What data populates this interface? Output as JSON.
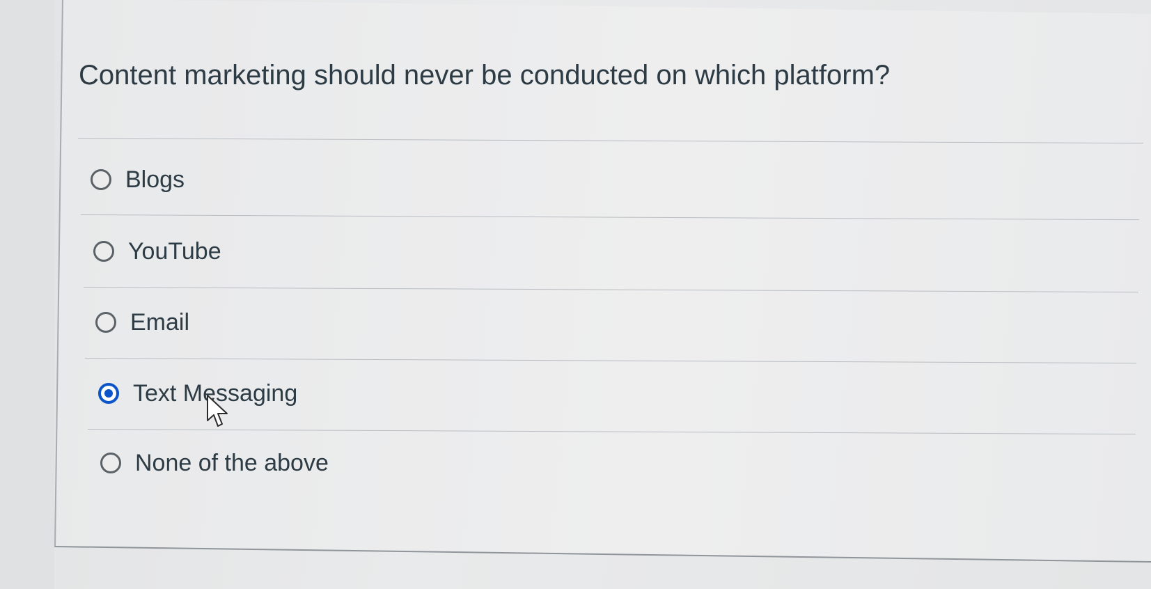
{
  "question": {
    "text": "Content marketing should never be conducted on which platform?"
  },
  "answers": [
    {
      "label": "Blogs",
      "selected": false
    },
    {
      "label": "YouTube",
      "selected": false
    },
    {
      "label": "Email",
      "selected": false
    },
    {
      "label": "Text Messaging",
      "selected": true
    },
    {
      "label": "None of the above",
      "selected": false
    }
  ],
  "colors": {
    "selected_accent": "#0b55c9",
    "text": "#2d3b45",
    "background": "#e8e9ea",
    "divider": "#b9bdc1"
  },
  "icons": {
    "pointer": "mouse-pointer-icon",
    "radio_unselected": "radio-empty-icon",
    "radio_selected": "radio-filled-icon"
  }
}
